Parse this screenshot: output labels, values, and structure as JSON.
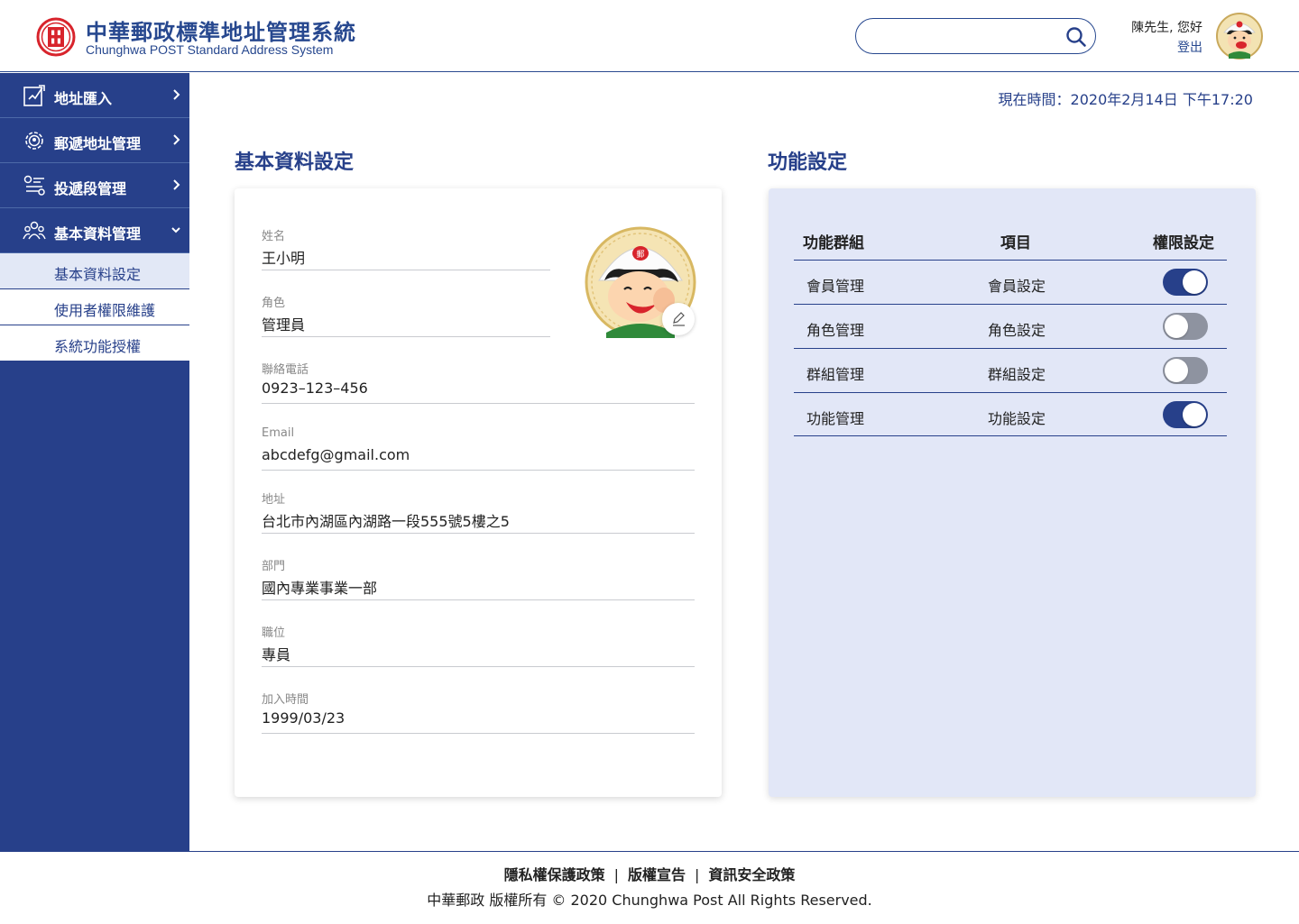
{
  "header": {
    "brand_zh": "中華郵政標準地址管理系統",
    "brand_en": "Chunghwa POST Standard Address System",
    "logo_char": "郵",
    "search": {
      "placeholder": "",
      "value": ""
    },
    "greeting": "陳先生, 您好",
    "logout": "登出"
  },
  "sidebar": {
    "items": [
      {
        "label": "地址匯入",
        "icon": "import-icon"
      },
      {
        "label": "郵遞地址管理",
        "icon": "gear-pin-icon"
      },
      {
        "label": "投遞段管理",
        "icon": "route-icon"
      },
      {
        "label": "基本資料管理",
        "icon": "people-icon"
      }
    ],
    "sub_items": [
      {
        "label": "基本資料設定",
        "active": true
      },
      {
        "label": "使用者權限維護",
        "active": false
      },
      {
        "label": "系統功能授權",
        "active": false
      }
    ]
  },
  "main": {
    "now_time": "現在時間：2020年2月14日 下午17:20",
    "profile": {
      "title": "基本資料設定",
      "fields": [
        {
          "label": "姓名",
          "value": "王小明"
        },
        {
          "label": "角色",
          "value": "管理員"
        },
        {
          "label": "聯絡電話",
          "value": "0923–123–456"
        },
        {
          "label": "Email",
          "value": "abcdefg@gmail.com"
        },
        {
          "label": "地址",
          "value": "台北市內湖區內湖路一段555號5樓之5"
        },
        {
          "label": "部門",
          "value": "國內專業事業一部"
        },
        {
          "label": "職位",
          "value": "專員"
        },
        {
          "label": "加入時間",
          "value": "1999/03/23"
        }
      ]
    },
    "functions": {
      "title": "功能設定",
      "headers": {
        "group": "功能群組",
        "item": "項目",
        "permission": "權限設定"
      },
      "rows": [
        {
          "group": "會員管理",
          "item": "會員設定",
          "enabled": true
        },
        {
          "group": "角色管理",
          "item": "角色設定",
          "enabled": false
        },
        {
          "group": "群組管理",
          "item": "群組設定",
          "enabled": false
        },
        {
          "group": "功能管理",
          "item": "功能設定",
          "enabled": true
        }
      ]
    }
  },
  "footer": {
    "links": [
      "隱私權保護政策",
      "版權宣告",
      "資訊安全政策"
    ],
    "separator": "|",
    "copyright": "中華郵政 版權所有 © 2020 Chunghwa Post All Rights Reserved."
  },
  "colors": {
    "primary": "#27408a",
    "logo_red": "#d8242c",
    "func_card_bg": "#e2e7f7",
    "toggle_off": "#8e93a0"
  }
}
